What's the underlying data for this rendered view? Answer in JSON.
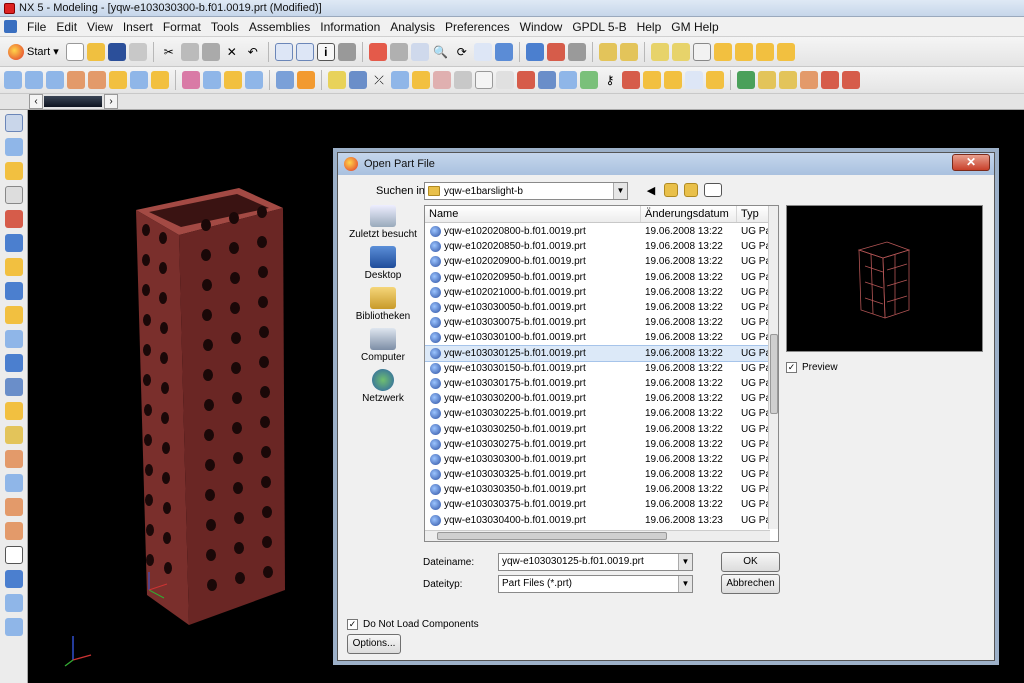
{
  "window": {
    "title": "NX 5 - Modeling - [yqw-e103030300-b.f01.0019.prt (Modified)]"
  },
  "menubar": {
    "items": [
      "File",
      "Edit",
      "View",
      "Insert",
      "Format",
      "Tools",
      "Assemblies",
      "Information",
      "Analysis",
      "Preferences",
      "Window",
      "GPDL 5-B",
      "Help",
      "GM Help"
    ]
  },
  "toolbar": {
    "start_label": "Start"
  },
  "dialog": {
    "title": "Open Part File",
    "close_label": "✕",
    "lookin_label": "Suchen in:",
    "lookin_value": "yqw-e1barslight-b",
    "places": [
      {
        "label": "Zuletzt besucht",
        "icon": "recent-places-icon"
      },
      {
        "label": "Desktop",
        "icon": "desktop-icon"
      },
      {
        "label": "Bibliotheken",
        "icon": "libraries-icon"
      },
      {
        "label": "Computer",
        "icon": "computer-icon"
      },
      {
        "label": "Netzwerk",
        "icon": "network-icon"
      }
    ],
    "columns": {
      "name": "Name",
      "date": "Änderungsdatum",
      "type": "Typ"
    },
    "files": [
      {
        "name": "yqw-e102020800-b.f01.0019.prt",
        "date": "19.06.2008 13:22",
        "type": "UG Par"
      },
      {
        "name": "yqw-e102020850-b.f01.0019.prt",
        "date": "19.06.2008 13:22",
        "type": "UG Par"
      },
      {
        "name": "yqw-e102020900-b.f01.0019.prt",
        "date": "19.06.2008 13:22",
        "type": "UG Par"
      },
      {
        "name": "yqw-e102020950-b.f01.0019.prt",
        "date": "19.06.2008 13:22",
        "type": "UG Par"
      },
      {
        "name": "yqw-e102021000-b.f01.0019.prt",
        "date": "19.06.2008 13:22",
        "type": "UG Par"
      },
      {
        "name": "yqw-e103030050-b.f01.0019.prt",
        "date": "19.06.2008 13:22",
        "type": "UG Par"
      },
      {
        "name": "yqw-e103030075-b.f01.0019.prt",
        "date": "19.06.2008 13:22",
        "type": "UG Par"
      },
      {
        "name": "yqw-e103030100-b.f01.0019.prt",
        "date": "19.06.2008 13:22",
        "type": "UG Par"
      },
      {
        "name": "yqw-e103030125-b.f01.0019.prt",
        "date": "19.06.2008 13:22",
        "type": "UG Par",
        "selected": true
      },
      {
        "name": "yqw-e103030150-b.f01.0019.prt",
        "date": "19.06.2008 13:22",
        "type": "UG Par"
      },
      {
        "name": "yqw-e103030175-b.f01.0019.prt",
        "date": "19.06.2008 13:22",
        "type": "UG Par"
      },
      {
        "name": "yqw-e103030200-b.f01.0019.prt",
        "date": "19.06.2008 13:22",
        "type": "UG Par"
      },
      {
        "name": "yqw-e103030225-b.f01.0019.prt",
        "date": "19.06.2008 13:22",
        "type": "UG Par"
      },
      {
        "name": "yqw-e103030250-b.f01.0019.prt",
        "date": "19.06.2008 13:22",
        "type": "UG Par"
      },
      {
        "name": "yqw-e103030275-b.f01.0019.prt",
        "date": "19.06.2008 13:22",
        "type": "UG Par"
      },
      {
        "name": "yqw-e103030300-b.f01.0019.prt",
        "date": "19.06.2008 13:22",
        "type": "UG Par"
      },
      {
        "name": "yqw-e103030325-b.f01.0019.prt",
        "date": "19.06.2008 13:22",
        "type": "UG Par"
      },
      {
        "name": "yqw-e103030350-b.f01.0019.prt",
        "date": "19.06.2008 13:22",
        "type": "UG Par"
      },
      {
        "name": "yqw-e103030375-b.f01.0019.prt",
        "date": "19.06.2008 13:22",
        "type": "UG Par"
      },
      {
        "name": "yqw-e103030400-b.f01.0019.prt",
        "date": "19.06.2008 13:23",
        "type": "UG Par"
      }
    ],
    "preview_label": "Preview",
    "preview_checked": true,
    "filename_label": "Dateiname:",
    "filename_value": "yqw-e103030125-b.f01.0019.prt",
    "filetype_label": "Dateityp:",
    "filetype_value": "Part Files (*.prt)",
    "ok_label": "OK",
    "cancel_label": "Abbrechen",
    "donotload_label": "Do Not Load Components",
    "donotload_checked": true,
    "options_label": "Options..."
  },
  "colors": {
    "part": "#7a2f2c",
    "selection": "#dce9f8",
    "accent": "#3a6fc0"
  }
}
